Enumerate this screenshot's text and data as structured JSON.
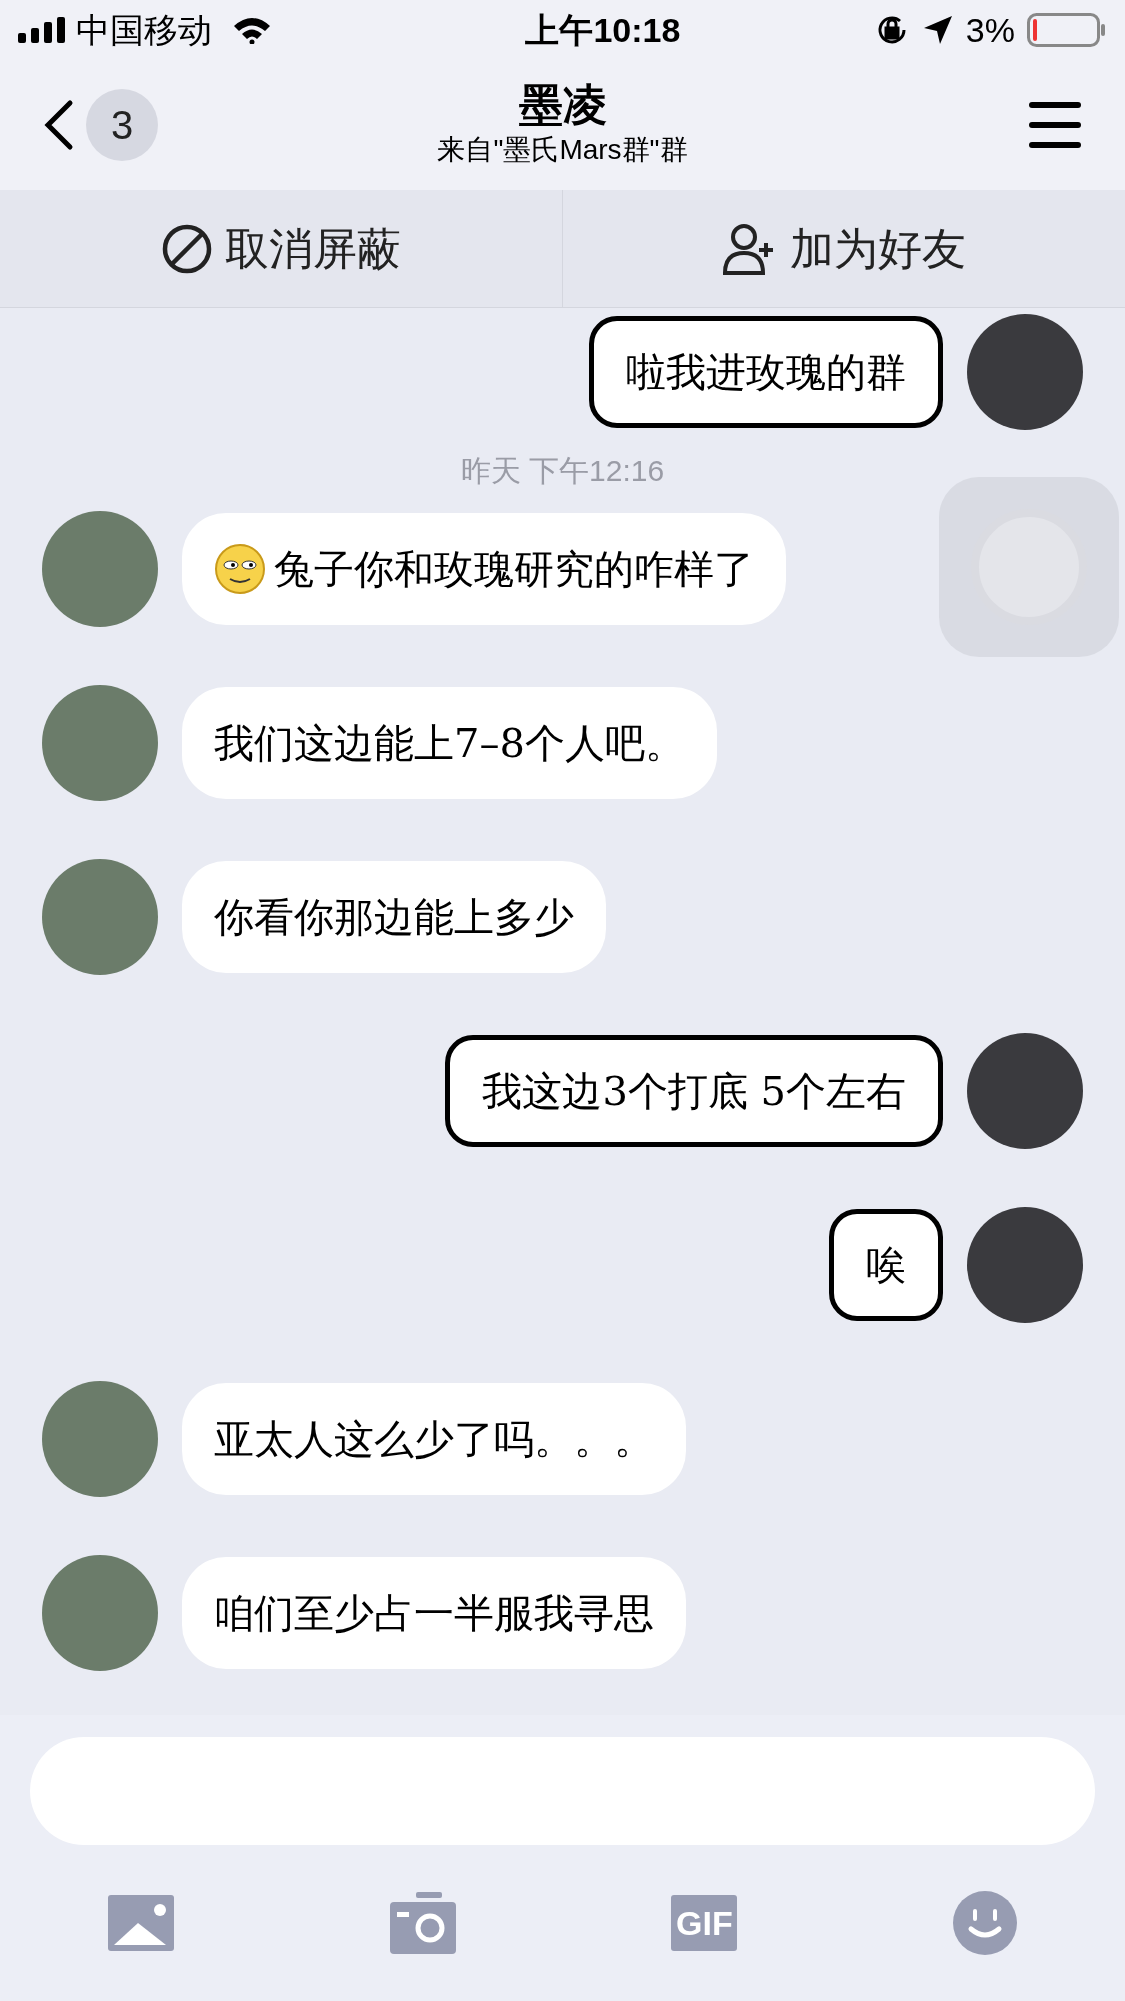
{
  "status_bar": {
    "carrier": "中国移动",
    "time": "上午10:18",
    "battery": "3%"
  },
  "header": {
    "back_count": "3",
    "title": "墨凌",
    "subtitle": "来自\"墨氏Mars群\"群"
  },
  "actions": [
    {
      "kind": "unblock",
      "label": "取消屏蔽"
    },
    {
      "kind": "add_friend",
      "label": "加为好友"
    }
  ],
  "messages": [
    {
      "kind": "message",
      "from_me": true,
      "text": "啦我进玫瑰的群",
      "leading_icon": false
    },
    {
      "kind": "time",
      "text": "昨天 下午12:16"
    },
    {
      "kind": "message",
      "from_me": false,
      "text": "兔子你和玫瑰研究的咋样了",
      "leading_icon": true
    },
    {
      "kind": "message",
      "from_me": false,
      "text": "我们这边能上7–8个人吧。",
      "leading_icon": false
    },
    {
      "kind": "message",
      "from_me": false,
      "text": "你看你那边能上多少",
      "leading_icon": false
    },
    {
      "kind": "message",
      "from_me": true,
      "text": "我这边3个打底 5个左右",
      "leading_icon": false
    },
    {
      "kind": "message",
      "from_me": true,
      "text": "唉",
      "leading_icon": false
    },
    {
      "kind": "message",
      "from_me": false,
      "text": "亚太人这么少了吗。。。",
      "leading_icon": false
    },
    {
      "kind": "message",
      "from_me": false,
      "text": "咱们至少占一半服我寻思",
      "leading_icon": false
    }
  ],
  "toolbar": [
    {
      "kind": "image"
    },
    {
      "kind": "camera"
    },
    {
      "kind": "gif",
      "label": "GIF"
    },
    {
      "kind": "emoji"
    }
  ]
}
